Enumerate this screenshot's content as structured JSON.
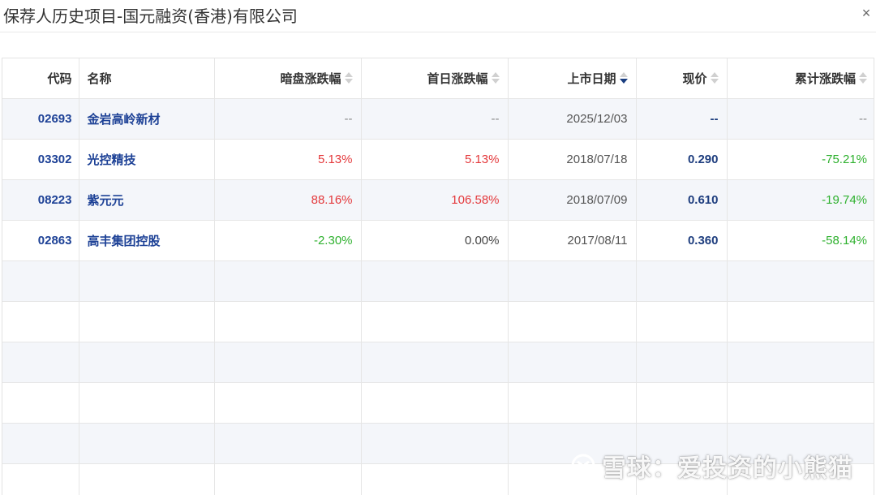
{
  "window": {
    "title": "保荐人历史项目-国元融资(香港)有限公司",
    "close_label": "×"
  },
  "table": {
    "headers": {
      "code": "代码",
      "name": "名称",
      "grey": "暗盘涨跌幅",
      "first_day": "首日涨跌幅",
      "list_date": "上市日期",
      "price": "现价",
      "cumulative": "累计涨跌幅"
    },
    "sorted_column": "list_date",
    "sort_direction": "desc",
    "rows": [
      {
        "code": "02693",
        "name": "金岩高岭新材",
        "grey": "--",
        "first_day": "--",
        "list_date": "2025/12/03",
        "price": "--",
        "cumulative": "--",
        "grey_state": "dim",
        "first_state": "dim",
        "cum_state": "dim"
      },
      {
        "code": "03302",
        "name": "光控精技",
        "grey": "5.13%",
        "first_day": "5.13%",
        "list_date": "2018/07/18",
        "price": "0.290",
        "cumulative": "-75.21%",
        "grey_state": "up",
        "first_state": "up",
        "cum_state": "down"
      },
      {
        "code": "08223",
        "name": "紫元元",
        "grey": "88.16%",
        "first_day": "106.58%",
        "list_date": "2018/07/09",
        "price": "0.610",
        "cumulative": "-19.74%",
        "grey_state": "up",
        "first_state": "up",
        "cum_state": "down"
      },
      {
        "code": "02863",
        "name": "高丰集团控股",
        "grey": "-2.30%",
        "first_day": "0.00%",
        "list_date": "2017/08/11",
        "price": "0.360",
        "cumulative": "-58.14%",
        "grey_state": "down",
        "first_state": "flat",
        "cum_state": "down"
      }
    ],
    "empty_row_count": 6
  },
  "colors": {
    "link": "#1d4196",
    "up": "#e4393c",
    "down": "#2fb12f",
    "stripe": "#f4f6fa",
    "sort_active": "#1a3e80"
  },
  "watermark": {
    "text": "雪球：爱投资的小熊猫",
    "icon": "snowball-logo-icon"
  }
}
